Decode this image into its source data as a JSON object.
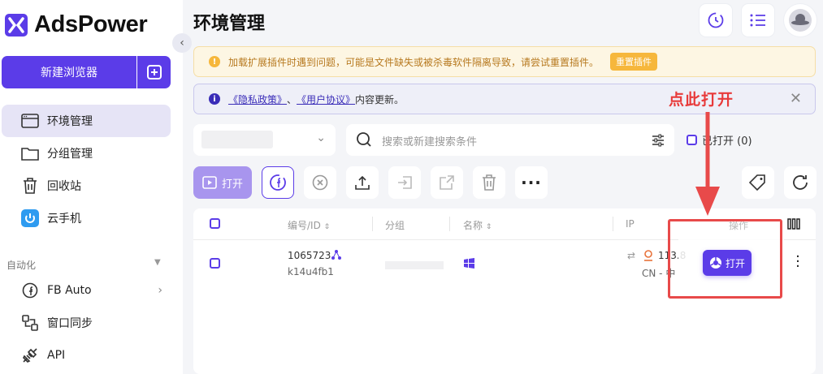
{
  "app": {
    "name": "AdsPower"
  },
  "sidebar": {
    "new_browser_label": "新建浏览器",
    "items": [
      {
        "label": "环境管理",
        "icon": "browser-window-icon",
        "active": true
      },
      {
        "label": "分组管理",
        "icon": "folder-icon"
      },
      {
        "label": "回收站",
        "icon": "trash-icon"
      },
      {
        "label": "云手机",
        "icon": "cloud-phone-icon"
      }
    ],
    "section_label": "自动化",
    "automation_items": [
      {
        "label": "FB Auto",
        "icon": "facebook-circle-icon"
      },
      {
        "label": "窗口同步",
        "icon": "window-sync-icon"
      },
      {
        "label": "API",
        "icon": "api-plug-icon"
      }
    ]
  },
  "header": {
    "title": "环境管理"
  },
  "banners": {
    "warning_text": "加载扩展插件时遇到问题，可能是文件缺失或被杀毒软件隔离导致，请尝试重置插件。",
    "reset_label": "重置插件",
    "info_prefix": "《隐私政策》",
    "info_sep": "、",
    "info_link2": "《用户协议》",
    "info_suffix": "内容更新。"
  },
  "annotation": {
    "text": "点此打开",
    "color": "#e83a3a"
  },
  "filters": {
    "search_placeholder": "搜索或新建搜索条件",
    "opened_label": "已打开 (0)"
  },
  "toolbar": {
    "open_label": "打开"
  },
  "table": {
    "headers": {
      "id": "编号/ID",
      "group": "分组",
      "name": "名称",
      "ip": "IP",
      "action": "操作"
    },
    "rows": [
      {
        "number": "1065723",
        "id": "k14u4fb1",
        "group": "",
        "ip": "113.8",
        "country": "CN - 中",
        "open_label": "打开"
      }
    ]
  },
  "colors": {
    "primary": "#5b3ce8",
    "annotation": "#e84a4a",
    "warning": "#f6b73c"
  }
}
